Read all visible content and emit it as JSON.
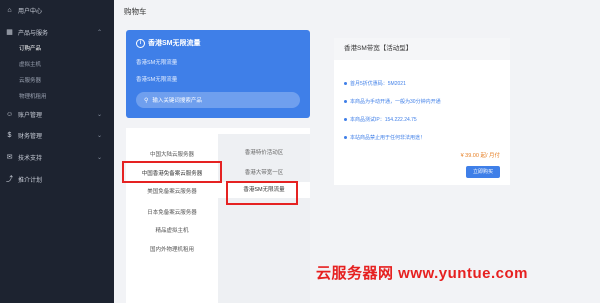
{
  "sidebar": {
    "items": [
      {
        "label": "用户中心",
        "icon": "home-icon",
        "arrow": ""
      },
      {
        "label": "产品与服务",
        "icon": "grid-icon",
        "arrow": "⌃"
      },
      {
        "label": "账户管理",
        "icon": "user-icon",
        "arrow": "⌄"
      },
      {
        "label": "财务管理",
        "icon": "dollar-icon",
        "arrow": "⌄"
      },
      {
        "label": "技术支持",
        "icon": "support-icon",
        "arrow": "⌄"
      },
      {
        "label": "推介计划",
        "icon": "share-icon",
        "arrow": ""
      }
    ],
    "sub_items": [
      "订购产品",
      "虚拟主机",
      "云服务器",
      "物理机租用"
    ]
  },
  "page_title": "购物车",
  "blue_panel": {
    "heading": "香港SM无限流量",
    "line1": "香港SM无限流量",
    "line2": "香港SM无限流量",
    "search_placeholder": "输入关键词搜索产品"
  },
  "categories": [
    "中国大陆云服务器",
    "中国香港免备案云服务器",
    "美国免备案云服务器",
    "日本免备案云服务器",
    "精品虚拟主机",
    "国内外物理机租用"
  ],
  "subcategories": [
    "香港特价活动区",
    "香港大带宽一区",
    "香港SM无限流量"
  ],
  "product": {
    "title": "香港SM带宽【活动型】",
    "rows": [
      "首月5折优惠码：5M2021",
      "本商品为手动开通，一般为30分钟内开通",
      "本商品测试IP：154.222.24.75",
      "本站商品禁止用于任何非法用途！"
    ],
    "price": "¥ 39.00 起/ 月付",
    "buy_label": "立即购买"
  },
  "watermark": "云服务器网 www.yuntue.com"
}
